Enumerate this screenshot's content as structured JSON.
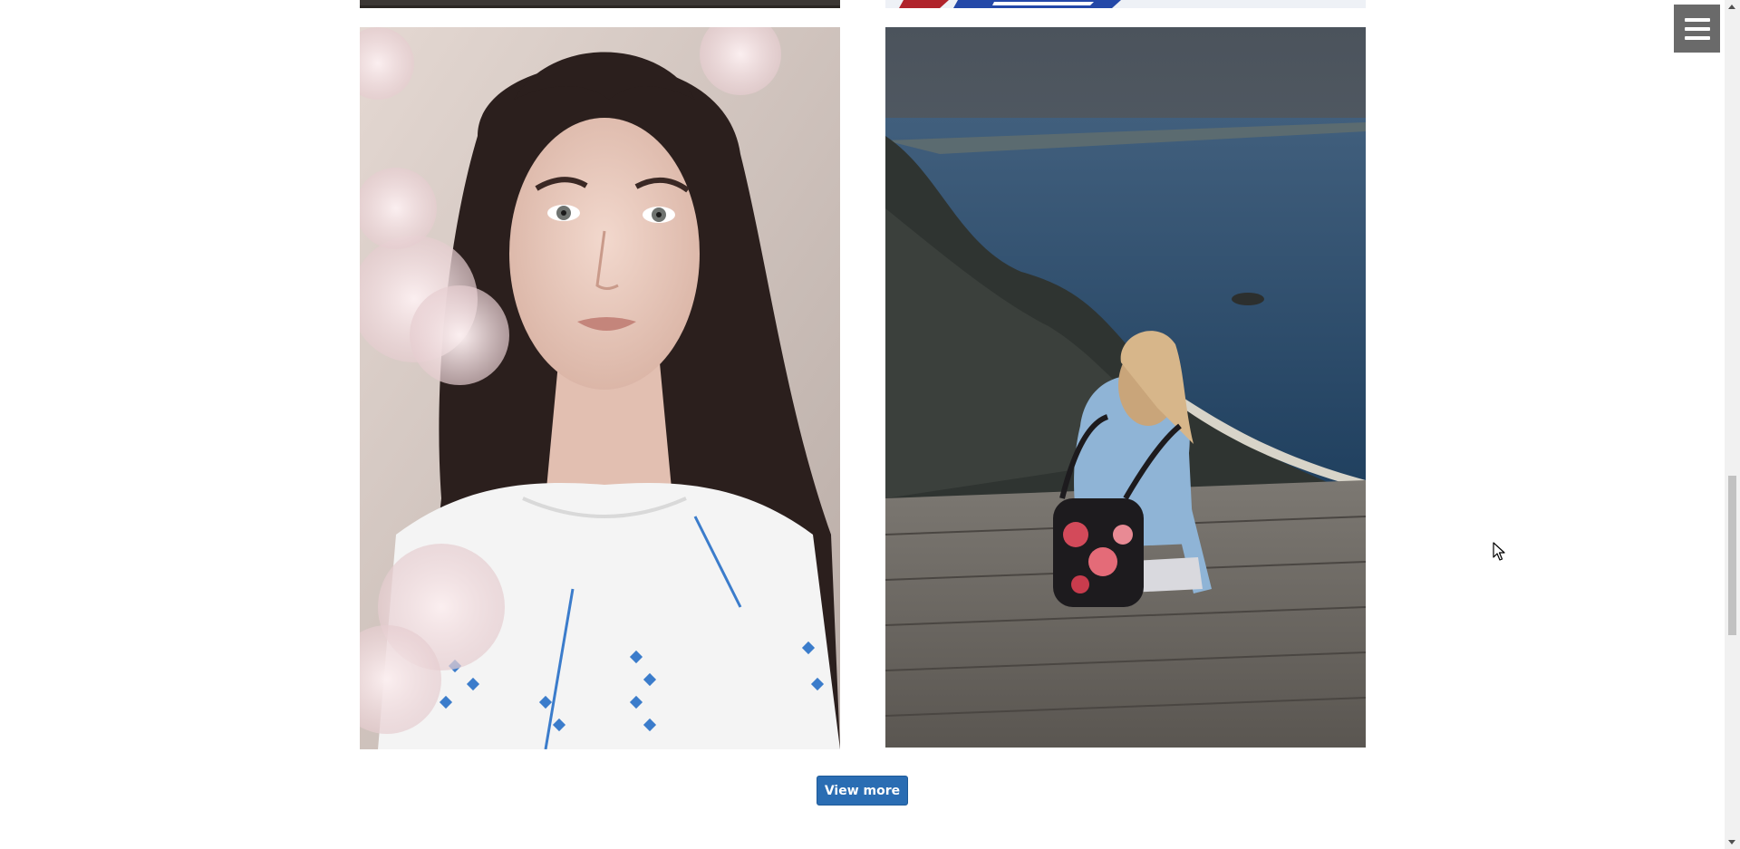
{
  "gallery": {
    "photos": [
      {
        "name": "partial-photo-top-left"
      },
      {
        "name": "partial-photo-top-right"
      },
      {
        "name": "portrait-woman-blossoms"
      },
      {
        "name": "woman-backpack-coastal-view"
      }
    ],
    "view_more_label": "View more"
  },
  "menu": {
    "icon": "hamburger-menu-icon"
  },
  "colors": {
    "button_bg": "#2a6db3",
    "menu_bg": "#6a6a6a",
    "page_bg": "#ffffff"
  }
}
